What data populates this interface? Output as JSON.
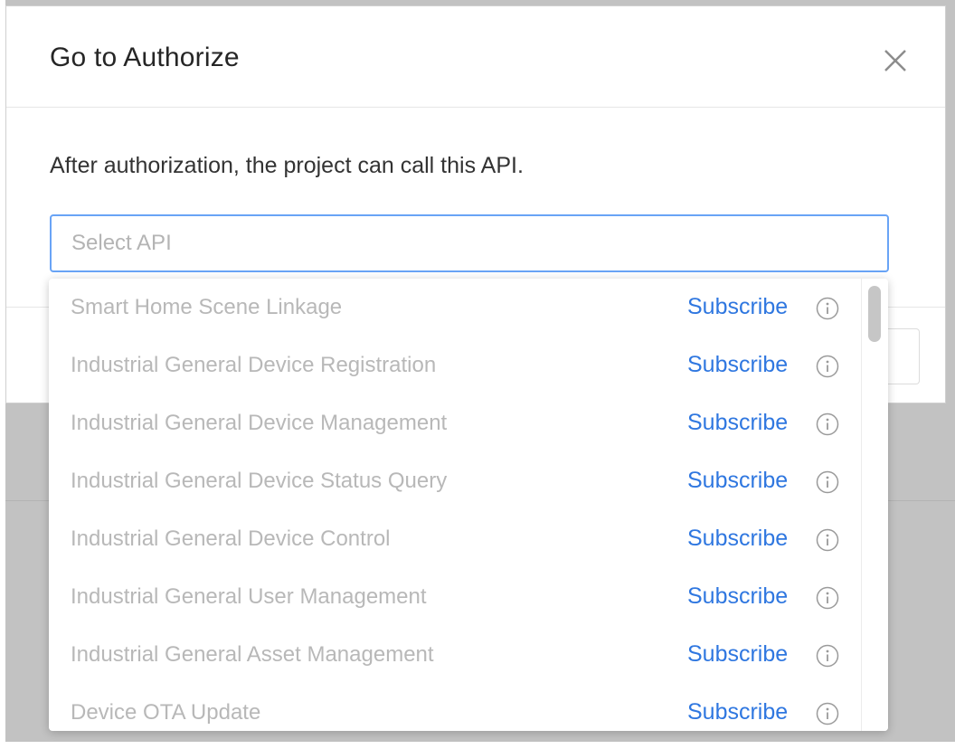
{
  "modal": {
    "title": "Go to Authorize",
    "description": "After authorization, the project can call this API.",
    "close_icon": "close-icon"
  },
  "select": {
    "placeholder": "Select API"
  },
  "dropdown": {
    "options": [
      {
        "label": "Smart Home Scene Linkage",
        "action": "Subscribe",
        "icon": "info-icon"
      },
      {
        "label": "Industrial General Device Registration",
        "action": "Subscribe",
        "icon": "info-icon"
      },
      {
        "label": "Industrial General Device Management",
        "action": "Subscribe",
        "icon": "info-icon"
      },
      {
        "label": "Industrial General Device Status Query",
        "action": "Subscribe",
        "icon": "info-icon"
      },
      {
        "label": "Industrial General Device Control",
        "action": "Subscribe",
        "icon": "info-icon"
      },
      {
        "label": "Industrial General User Management",
        "action": "Subscribe",
        "icon": "info-icon"
      },
      {
        "label": "Industrial General Asset Management",
        "action": "Subscribe",
        "icon": "info-icon"
      },
      {
        "label": "Device OTA Update",
        "action": "Subscribe",
        "icon": "info-icon"
      }
    ]
  },
  "colors": {
    "accent": "#2f77e0",
    "focus_border": "#69a4f6",
    "disabled_text": "#b8b8b8",
    "overlay": "#c2c2c2"
  }
}
